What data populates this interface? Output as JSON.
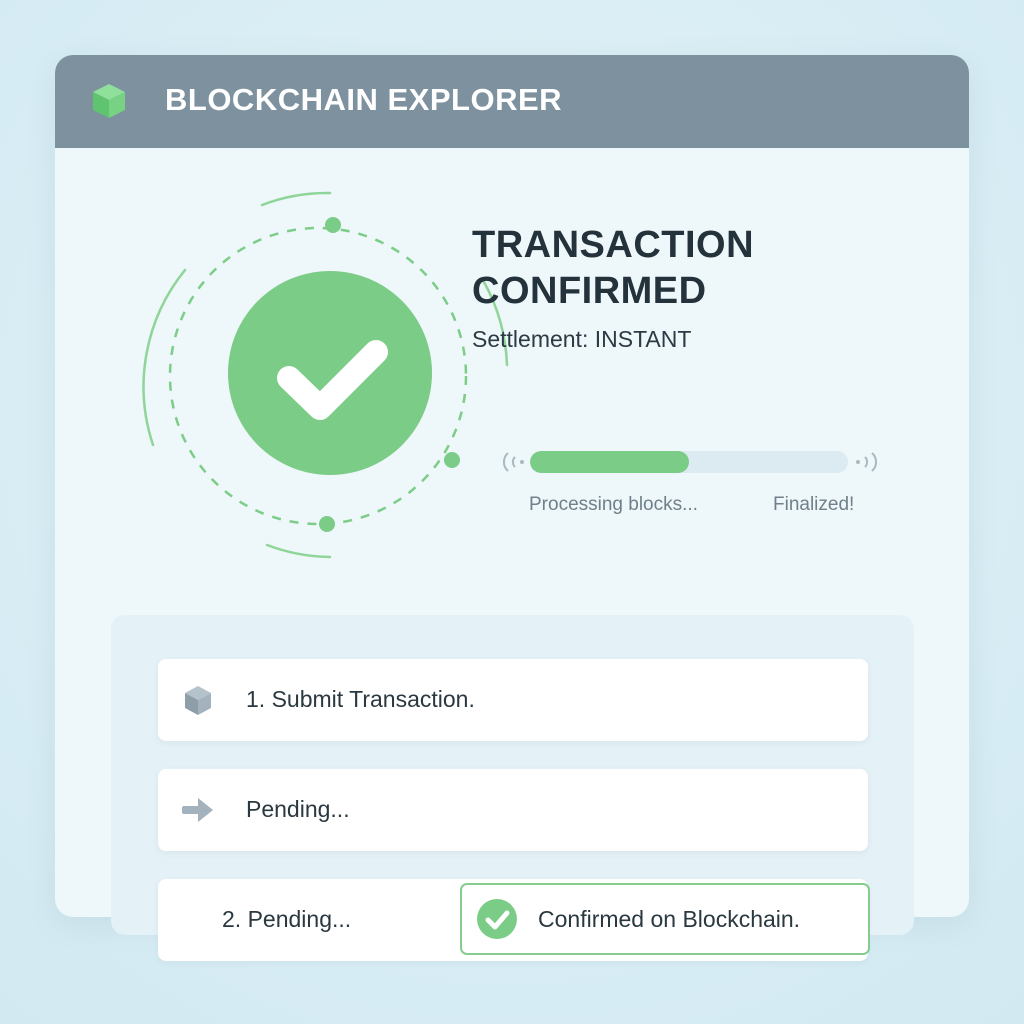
{
  "header": {
    "title": "BLOCKCHAIN EXPLORER",
    "logo_icon": "cube-icon"
  },
  "status": {
    "title_line1": "TRANSACTION",
    "title_line2": "CONFIRMED",
    "settlement_label": "Settlement:",
    "settlement_value": "INSTANT",
    "icon": "check-circle-icon"
  },
  "progress": {
    "fraction": 0.5,
    "label_left": "Processing blocks...",
    "label_right": "Finalized!"
  },
  "steps": [
    {
      "icon": "cube-icon",
      "label": "1. Submit Transaction."
    },
    {
      "icon": "arrow-right-icon",
      "label": "Pending..."
    },
    {
      "label": "2. Pending...",
      "confirmed_label": "Confirmed on Blockchain.",
      "confirmed_icon": "check-circle-icon"
    }
  ],
  "colors": {
    "accent_green": "#7bcc86",
    "header_bg": "#7d919f",
    "text_dark": "#24323c"
  }
}
